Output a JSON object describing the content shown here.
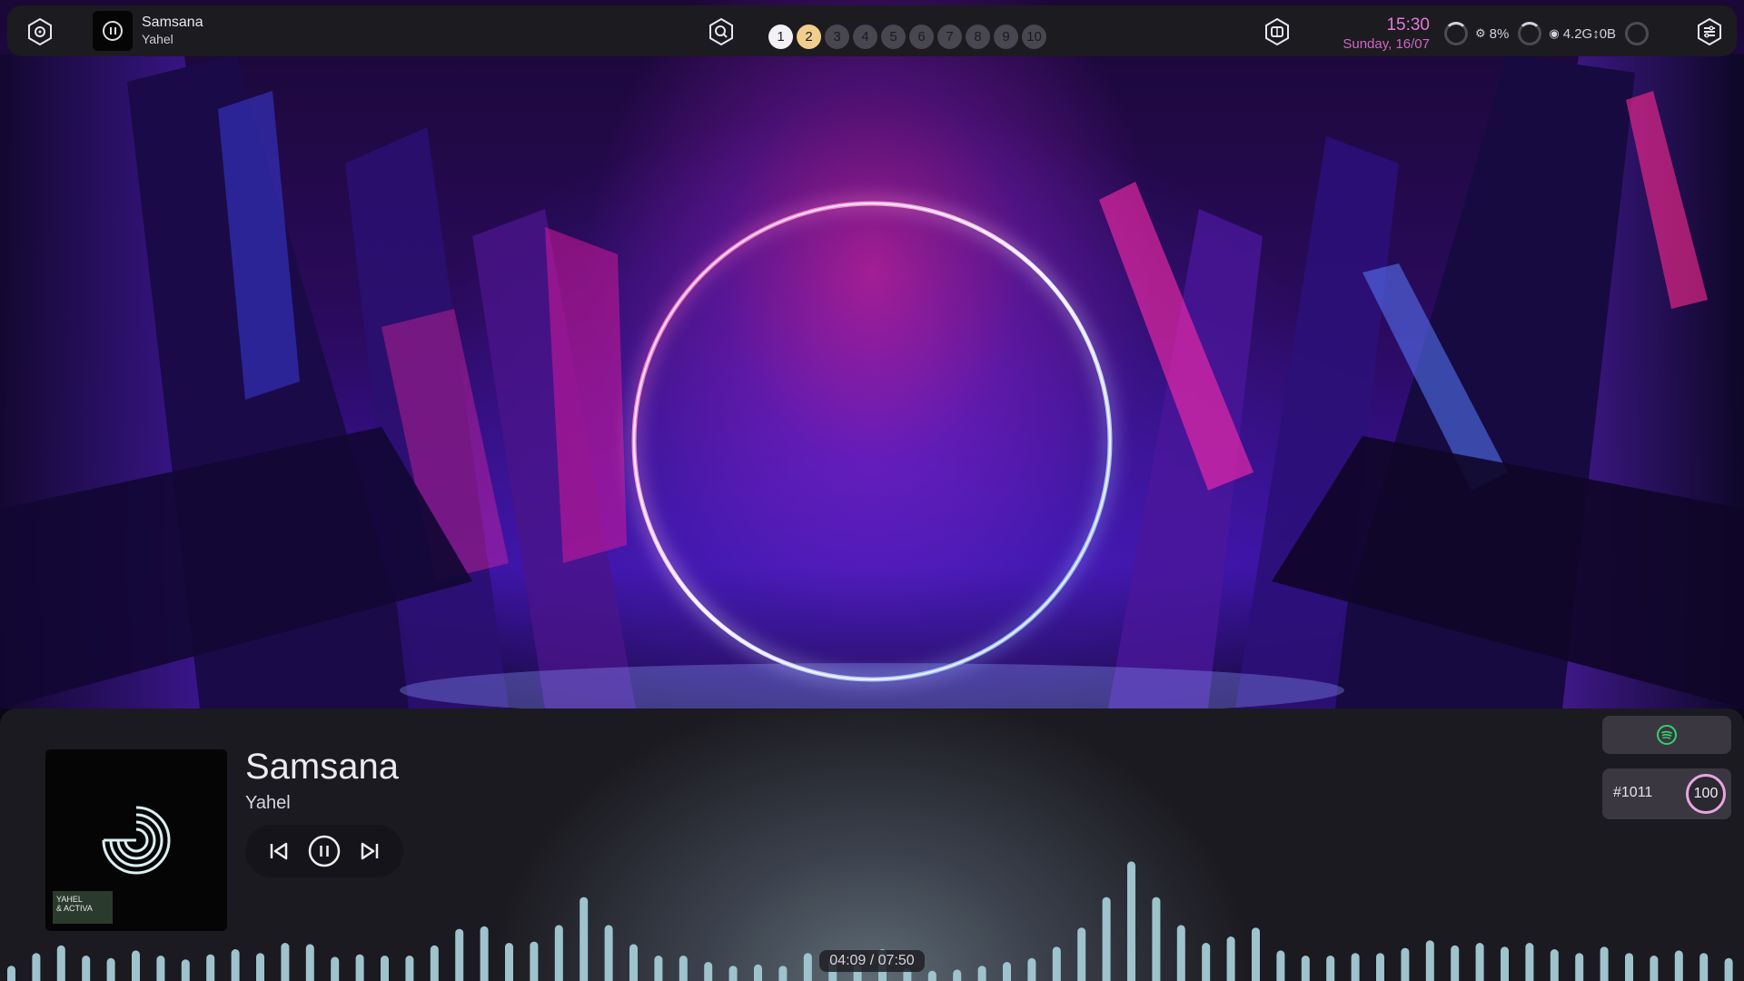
{
  "topbar": {
    "media": {
      "title": "Samsana",
      "artist": "Yahel"
    },
    "workspaces": [
      {
        "label": "1",
        "state": "active"
      },
      {
        "label": "2",
        "state": "occupied"
      },
      {
        "label": "3",
        "state": "empty"
      },
      {
        "label": "4",
        "state": "empty"
      },
      {
        "label": "5",
        "state": "empty"
      },
      {
        "label": "6",
        "state": "empty"
      },
      {
        "label": "7",
        "state": "empty"
      },
      {
        "label": "8",
        "state": "empty"
      },
      {
        "label": "9",
        "state": "empty"
      },
      {
        "label": "10",
        "state": "empty"
      }
    ],
    "clock": {
      "time": "15:30",
      "date": "Sunday, 16/07"
    },
    "stats": {
      "cpu": "8%",
      "network": "4.2G↕0B"
    },
    "icons": [
      "settings-icon",
      "pause-icon",
      "search-icon",
      "apps-icon",
      "sliders-icon"
    ]
  },
  "player": {
    "title": "Samsana",
    "artist": "Yahel",
    "cover_text": "YAHEL\n& ACTIVA",
    "position": "04:09 / 07:50",
    "playlist": "#1011",
    "volume": "100",
    "source_icon": "spotify-icon",
    "visualizer_levels": [
      0.12,
      0.22,
      0.28,
      0.2,
      0.18,
      0.24,
      0.2,
      0.17,
      0.21,
      0.25,
      0.22,
      0.3,
      0.29,
      0.19,
      0.21,
      0.2,
      0.2,
      0.28,
      0.41,
      0.43,
      0.3,
      0.31,
      0.44,
      0.66,
      0.44,
      0.29,
      0.2,
      0.2,
      0.15,
      0.12,
      0.13,
      0.12,
      0.22,
      0.18,
      0.13,
      0.25,
      0.1,
      0.08,
      0.09,
      0.12,
      0.15,
      0.18,
      0.27,
      0.42,
      0.66,
      0.94,
      0.66,
      0.44,
      0.3,
      0.35,
      0.42,
      0.24,
      0.2,
      0.2,
      0.22,
      0.22,
      0.26,
      0.32,
      0.28,
      0.3,
      0.27,
      0.3,
      0.25,
      0.22,
      0.27,
      0.22,
      0.2,
      0.24,
      0.22,
      0.18
    ]
  },
  "colors": {
    "accent": "#e27ad9",
    "workspace_active": "#f3f1f6",
    "workspace_occupied": "#f1cd8e",
    "bar_bg": "#1c1b20",
    "visualizer": "#9ec3cc",
    "spotify": "#35d06c"
  }
}
